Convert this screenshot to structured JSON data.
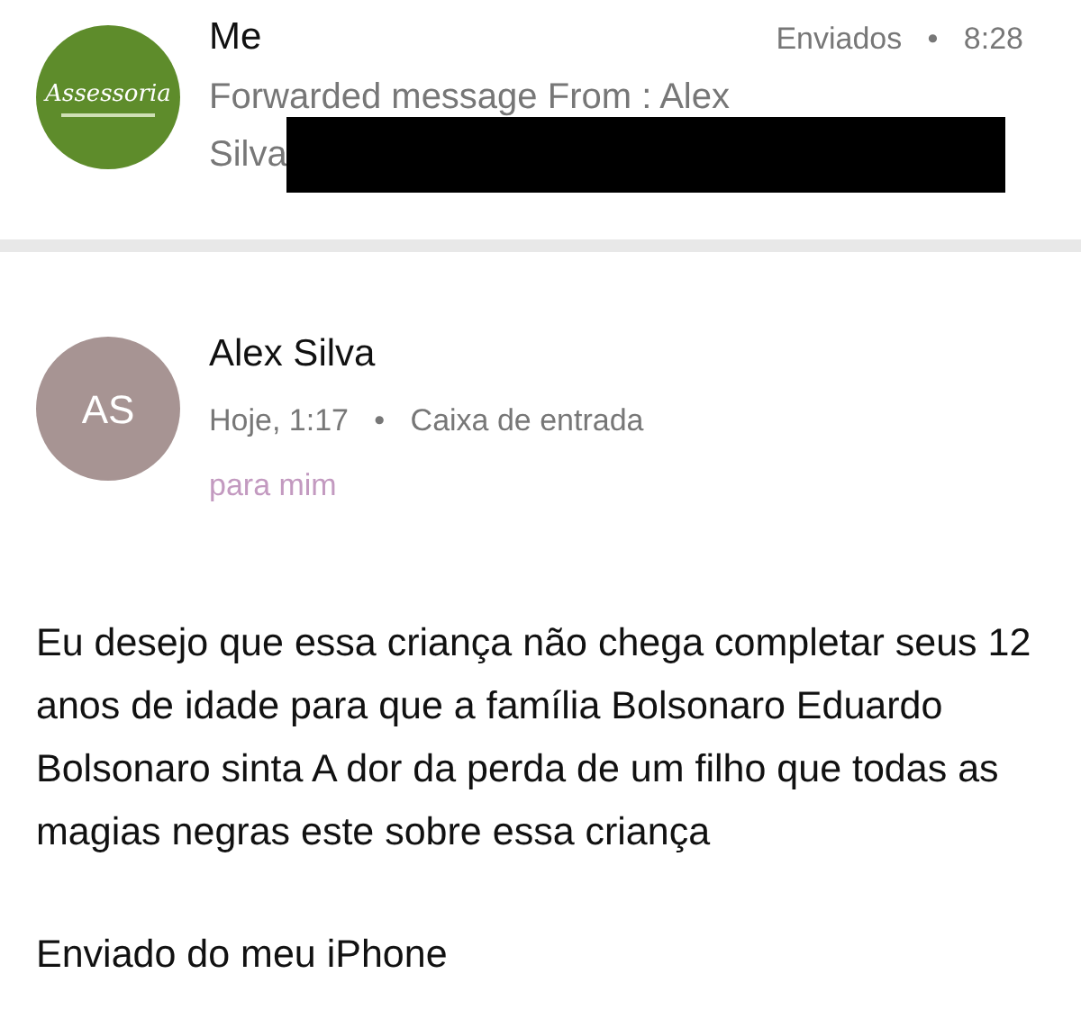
{
  "messages": [
    {
      "kind": "forwarded",
      "avatar": {
        "text": "Assessoria",
        "color": "#5e8c2b"
      },
      "sender": "Me",
      "folder": "Enviados",
      "separator": "•",
      "time": "8:28",
      "preview": "Forwarded message From : Alex",
      "preview_2": "Silva",
      "redacted": true
    },
    {
      "kind": "opened",
      "avatar": {
        "text": "AS",
        "color": "#a79493"
      },
      "sender": "Alex Silva",
      "date": "Hoje, 1:17",
      "separator": "•",
      "folder": "Caixa de entrada",
      "recipient": "para mim",
      "body": "Eu desejo que essa criança não chega completar seus 12 anos de idade para que a família Bolsonaro Eduardo Bolsonaro sinta A dor da perda de um filho que todas as magias negras este sobre essa criança",
      "signature": "Enviado do meu iPhone"
    }
  ]
}
